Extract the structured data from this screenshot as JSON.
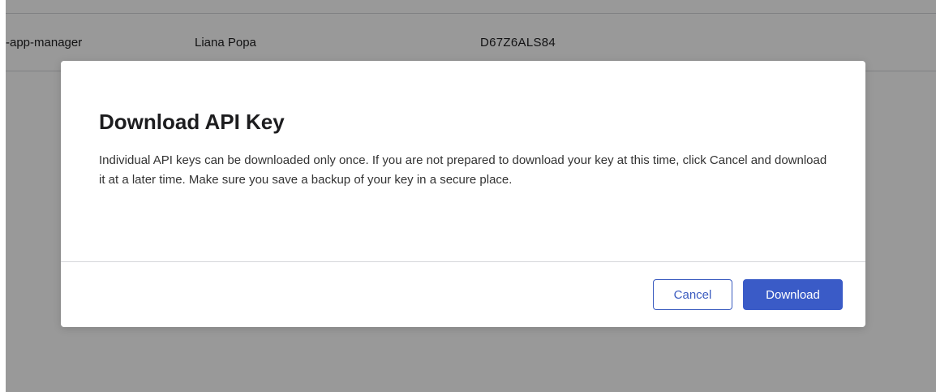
{
  "background_table": {
    "row": {
      "role": "-app-manager",
      "name": "Liana Popa",
      "key_id": "D67Z6ALS84"
    }
  },
  "modal": {
    "title": "Download API Key",
    "body": "Individual API keys can be downloaded only once. If you are not prepared to download your key at this time, click Cancel and download it at a later time. Make sure you save a backup of your key in a secure place.",
    "cancel_label": "Cancel",
    "download_label": "Download"
  },
  "colors": {
    "accent": "#3a5bc7",
    "overlay": "rgba(0,0,0,0.40)"
  }
}
